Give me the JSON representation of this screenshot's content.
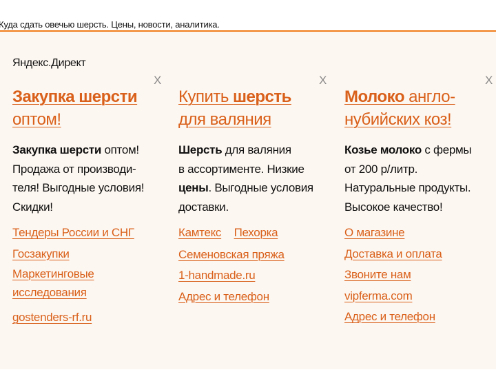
{
  "header": {
    "title": "Куда сдать овечью шерсть. Цены, новости, аналитика."
  },
  "direct_label": "Яндекс.Директ",
  "close_glyph": "X",
  "ads": [
    {
      "title_line1_bold": "Закупка шерсти",
      "title_line2": "оптом!",
      "text_line1_bold": "Закупка шерсти",
      "text_line1_rest": " оптом!",
      "text_line2": "Продажа от производи-",
      "text_line3": "теля! Выгодные условия!",
      "text_line4": "Скидки!",
      "links": [
        "Тендеры России и СНГ",
        "Госзакупки",
        "Маркетинговые",
        "исследования",
        "gostenders-rf.ru"
      ]
    },
    {
      "title_line1_normal": "Купить ",
      "title_line1_bold": "шерсть",
      "title_line2": "для валяния",
      "text_line1_bold": "Шерсть",
      "text_line1_rest": " для валяния",
      "text_line2": "в ассортименте. Низкие",
      "text_line3_bold": "цены",
      "text_line3_rest": ". Выгодные условия",
      "text_line4": "доставки.",
      "links": [
        "Камтекс",
        "Пехорка",
        "Семеновская пряжа",
        "1-handmade.ru",
        "Адрес и телефон"
      ]
    },
    {
      "title_line1_bold": "Молоко",
      "title_line1_rest": " англо-",
      "title_line2": "нубийских коз!",
      "text_line1_bold": "Козье молоко",
      "text_line1_rest": " с фермы",
      "text_line2": "от 200 р/литр.",
      "text_line3": "Натуральные продукты.",
      "text_line4": "Высокое качество!",
      "links": [
        "О магазине",
        "Доставка и оплата",
        "Звоните нам",
        "vipferma.com",
        "Адрес и телефон"
      ]
    }
  ],
  "colors": {
    "accent": "#d9601a",
    "header_line": "#f07c1a",
    "background": "#fdf7f1"
  }
}
